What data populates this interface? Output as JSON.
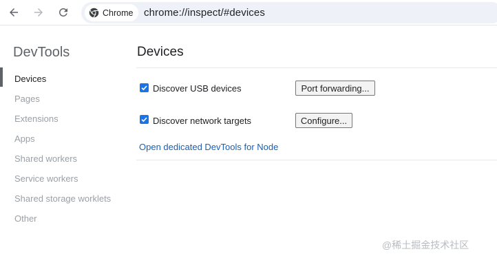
{
  "toolbar": {
    "site_chip_label": "Chrome",
    "url": "chrome://inspect/#devices"
  },
  "sidebar": {
    "title": "DevTools",
    "items": [
      {
        "label": "Devices",
        "active": true
      },
      {
        "label": "Pages",
        "active": false
      },
      {
        "label": "Extensions",
        "active": false
      },
      {
        "label": "Apps",
        "active": false
      },
      {
        "label": "Shared workers",
        "active": false
      },
      {
        "label": "Service workers",
        "active": false
      },
      {
        "label": "Shared storage worklets",
        "active": false
      },
      {
        "label": "Other",
        "active": false
      }
    ]
  },
  "main": {
    "title": "Devices",
    "options": [
      {
        "label": "Discover USB devices",
        "checked": true,
        "button_label": "Port forwarding..."
      },
      {
        "label": "Discover network targets",
        "checked": true,
        "button_label": "Configure..."
      }
    ],
    "node_link": "Open dedicated DevTools for Node"
  },
  "watermark": "@稀土掘金技术社区",
  "colors": {
    "accent": "#1a73e8",
    "link": "#1a5fb4",
    "omnibox_bg": "#eef1f8",
    "inactive_text": "#9aa0a6"
  },
  "icons": {
    "back": "arrow-left-icon",
    "forward": "arrow-right-icon",
    "reload": "reload-icon",
    "site": "chrome-logo-icon",
    "checkbox": "checkmark-icon"
  }
}
